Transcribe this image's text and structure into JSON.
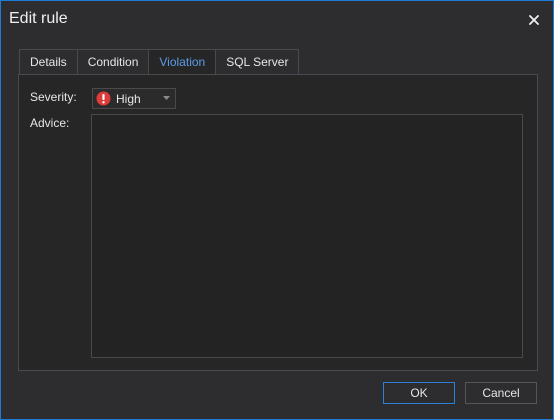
{
  "window": {
    "title": "Edit rule"
  },
  "tabs": [
    {
      "label": "Details"
    },
    {
      "label": "Condition"
    },
    {
      "label": "Violation",
      "active": true
    },
    {
      "label": "SQL Server"
    }
  ],
  "violation": {
    "severity_label": "Severity:",
    "severity_value": "High",
    "severity_icon": "error-icon",
    "advice_label": "Advice:",
    "advice_value": ""
  },
  "buttons": {
    "ok": "OK",
    "cancel": "Cancel"
  },
  "colors": {
    "accent": "#2b80d6",
    "active_tab_text": "#5b9be8",
    "severity_high": "#e03b3b"
  }
}
